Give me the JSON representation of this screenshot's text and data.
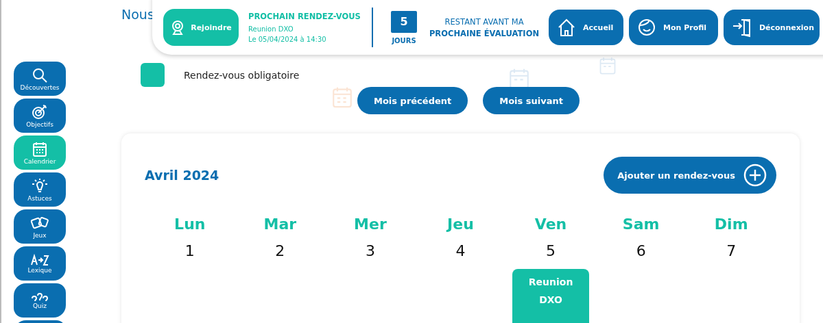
{
  "intro": {
    "text": "Nous"
  },
  "header": {
    "join_button": "Rejoindre",
    "next_meeting": {
      "title": "PROCHAIN RENDEZ-VOUS",
      "name": "Reunion DXO",
      "date": "Le 05/04/2024 à 14:30"
    },
    "countdown": {
      "days": "5",
      "unit": "JOURS",
      "line1": "RESTANT AVANT MA",
      "line2": "PROCHAINE ÉVALUATION"
    },
    "nav": [
      {
        "kind": "home",
        "label": "Accueil"
      },
      {
        "kind": "profile",
        "label": "Mon Profil"
      },
      {
        "kind": "logout",
        "label": "Déconnexion"
      }
    ]
  },
  "sidebar": {
    "items": [
      {
        "kind": "search",
        "label": "Découvertes",
        "selected": false
      },
      {
        "kind": "target",
        "label": "Objectifs",
        "selected": false
      },
      {
        "kind": "calendar",
        "label": "Calendrier",
        "selected": true
      },
      {
        "kind": "bulb",
        "label": "Astuces",
        "selected": false
      },
      {
        "kind": "dice",
        "label": "Jeux",
        "selected": false
      },
      {
        "kind": "az",
        "label": "Lexique",
        "selected": false
      },
      {
        "kind": "quiz",
        "label": "Quiz",
        "selected": false
      }
    ]
  },
  "legend": [
    {
      "label": "Rendez-vous obligatoire",
      "color": "#14bfa6"
    }
  ],
  "month_nav": [
    "Mois précédent",
    "Mois suivant"
  ],
  "calendar": {
    "month": "Avril",
    "year": "2024",
    "add_button": "Ajouter un rendez-vous",
    "days": [
      {
        "name": "Lun",
        "date": "1"
      },
      {
        "name": "Mar",
        "date": "2"
      },
      {
        "name": "Mer",
        "date": "3"
      },
      {
        "name": "Jeu",
        "date": "4"
      },
      {
        "name": "Ven",
        "date": "5",
        "events": [
          {
            "title": "Reunion DXO",
            "color": "#14bfa6"
          }
        ]
      },
      {
        "name": "Sam",
        "date": "6"
      },
      {
        "name": "Dim",
        "date": "7"
      }
    ]
  }
}
